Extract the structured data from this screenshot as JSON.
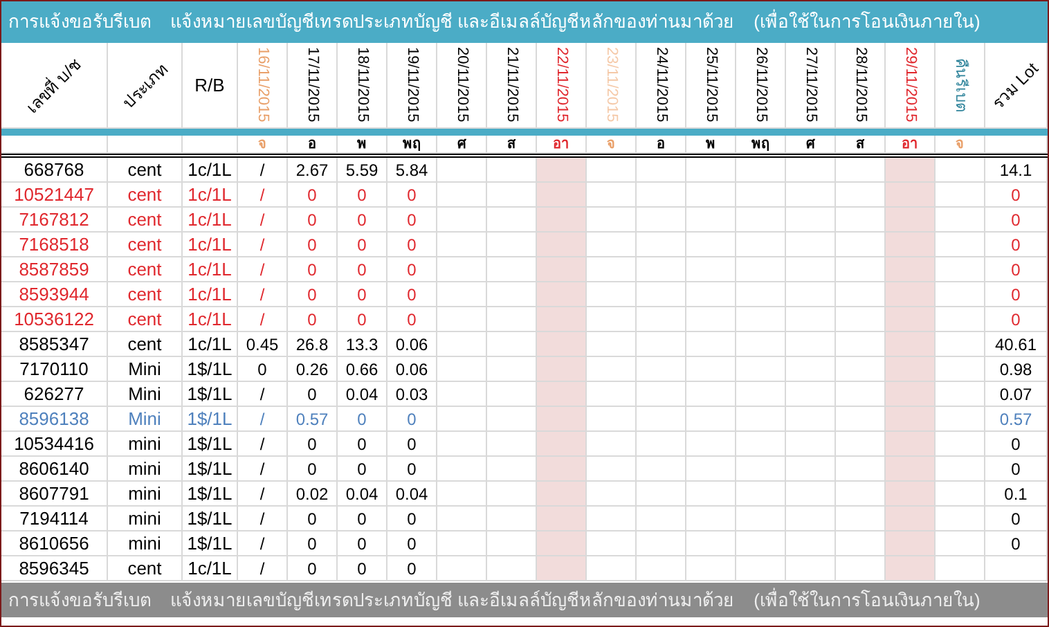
{
  "title": [
    "การแจ้งขอรับรีเบต",
    "แจ้งหมายเลขบัญชีเทรดประเภทบัญชี และอีเมลล์บัญชีหลักของท่านมาด้วย",
    "(เพื่อใช้ในการโอนเงินภายใน)"
  ],
  "columns": {
    "account": "เลขที่ บ/ช",
    "type": "ประเภท",
    "rb": "R/B",
    "rebate": "คืนรีเบต",
    "total": "รวม Lot"
  },
  "dates": [
    {
      "label": "16/11/2015",
      "color": "#e9a06a",
      "shaded": false,
      "weekday": {
        "label": "จ",
        "color": "#e9a06a"
      }
    },
    {
      "label": "17/11/2015",
      "color": "#000000",
      "shaded": false,
      "weekday": {
        "label": "อ",
        "color": "#000000"
      }
    },
    {
      "label": "18/11/2015",
      "color": "#000000",
      "shaded": false,
      "weekday": {
        "label": "พ",
        "color": "#000000"
      }
    },
    {
      "label": "19/11/2015",
      "color": "#000000",
      "shaded": false,
      "weekday": {
        "label": "พฤ",
        "color": "#000000"
      }
    },
    {
      "label": "20/11/2015",
      "color": "#000000",
      "shaded": false,
      "weekday": {
        "label": "ศ",
        "color": "#000000"
      }
    },
    {
      "label": "21/11/2015",
      "color": "#000000",
      "shaded": false,
      "weekday": {
        "label": "ส",
        "color": "#000000"
      }
    },
    {
      "label": "22/11/2015",
      "color": "#e0282e",
      "shaded": true,
      "weekday": {
        "label": "อา",
        "color": "#e0282e"
      }
    },
    {
      "label": "23/11/2015",
      "color": "#f5c9a8",
      "shaded": false,
      "weekday": {
        "label": "จ",
        "color": "#e9a06a"
      }
    },
    {
      "label": "24/11/2015",
      "color": "#000000",
      "shaded": false,
      "weekday": {
        "label": "อ",
        "color": "#000000"
      }
    },
    {
      "label": "25/11/2015",
      "color": "#000000",
      "shaded": false,
      "weekday": {
        "label": "พ",
        "color": "#000000"
      }
    },
    {
      "label": "26/11/2015",
      "color": "#000000",
      "shaded": false,
      "weekday": {
        "label": "พฤ",
        "color": "#000000"
      }
    },
    {
      "label": "27/11/2015",
      "color": "#000000",
      "shaded": false,
      "weekday": {
        "label": "ศ",
        "color": "#000000"
      }
    },
    {
      "label": "28/11/2015",
      "color": "#000000",
      "shaded": false,
      "weekday": {
        "label": "ส",
        "color": "#000000"
      }
    },
    {
      "label": "29/11/2015",
      "color": "#e0282e",
      "shaded": true,
      "weekday": {
        "label": "อา",
        "color": "#e0282e"
      }
    }
  ],
  "rebate_day": {
    "label": "จ",
    "color": "#e9a06a"
  },
  "rows": [
    {
      "account": "668768",
      "type": "cent",
      "rb": "1c/1L",
      "values": [
        "/",
        "2.67",
        "5.59",
        "5.84"
      ],
      "total": "14.1",
      "color": "#000000"
    },
    {
      "account": "10521447",
      "type": "cent",
      "rb": "1c/1L",
      "values": [
        "/",
        "0",
        "0",
        "0"
      ],
      "total": "0",
      "color": "#e0282e"
    },
    {
      "account": "7167812",
      "type": "cent",
      "rb": "1c/1L",
      "values": [
        "/",
        "0",
        "0",
        "0"
      ],
      "total": "0",
      "color": "#e0282e"
    },
    {
      "account": "7168518",
      "type": "cent",
      "rb": "1c/1L",
      "values": [
        "/",
        "0",
        "0",
        "0"
      ],
      "total": "0",
      "color": "#e0282e"
    },
    {
      "account": "8587859",
      "type": "cent",
      "rb": "1c/1L",
      "values": [
        "/",
        "0",
        "0",
        "0"
      ],
      "total": "0",
      "color": "#e0282e"
    },
    {
      "account": "8593944",
      "type": "cent",
      "rb": "1c/1L",
      "values": [
        "/",
        "0",
        "0",
        "0"
      ],
      "total": "0",
      "color": "#e0282e"
    },
    {
      "account": "10536122",
      "type": "cent",
      "rb": "1c/1L",
      "values": [
        "/",
        "0",
        "0",
        "0"
      ],
      "total": "0",
      "color": "#e0282e"
    },
    {
      "account": "8585347",
      "type": "cent",
      "rb": "1c/1L",
      "values": [
        "0.45",
        "26.8",
        "13.3",
        "0.06"
      ],
      "total": "40.61",
      "color": "#000000"
    },
    {
      "account": "7170110",
      "type": "Mini",
      "rb": "1$/1L",
      "values": [
        "0",
        "0.26",
        "0.66",
        "0.06"
      ],
      "total": "0.98",
      "color": "#000000"
    },
    {
      "account": "626277",
      "type": "Mini",
      "rb": "1$/1L",
      "values": [
        "/",
        "0",
        "0.04",
        "0.03"
      ],
      "total": "0.07",
      "color": "#000000"
    },
    {
      "account": "8596138",
      "type": "Mini",
      "rb": "1$/1L",
      "values": [
        "/",
        "0.57",
        "0",
        "0"
      ],
      "total": "0.57",
      "color": "#4f81bd"
    },
    {
      "account": "10534416",
      "type": "mini",
      "rb": "1$/1L",
      "values": [
        "/",
        "0",
        "0",
        "0"
      ],
      "total": "0",
      "color": "#000000"
    },
    {
      "account": "8606140",
      "type": "mini",
      "rb": "1$/1L",
      "values": [
        "/",
        "0",
        "0",
        "0"
      ],
      "total": "0",
      "color": "#000000"
    },
    {
      "account": "8607791",
      "type": "mini",
      "rb": "1$/1L",
      "values": [
        "/",
        "0.02",
        "0.04",
        "0.04"
      ],
      "total": "0.1",
      "color": "#000000"
    },
    {
      "account": "7194114",
      "type": "mini",
      "rb": "1$/1L",
      "values": [
        "/",
        "0",
        "0",
        "0"
      ],
      "total": "0",
      "color": "#000000"
    },
    {
      "account": "8610656",
      "type": "mini",
      "rb": "1$/1L",
      "values": [
        "/",
        "0",
        "0",
        "0"
      ],
      "total": "0",
      "color": "#000000"
    },
    {
      "account": "8596345",
      "type": "cent",
      "rb": "1c/1L",
      "values": [
        "/",
        "0",
        "0",
        "0"
      ],
      "color": "#000000"
    }
  ],
  "footer": [
    "การแจ้งขอรับรีเบต",
    "แจ้งหมายเลขบัญชีเทรดประเภทบัญชี และอีเมลล์บัญชีหลักของท่านมาด้วย",
    "(เพื่อใช้ในการโอนเงินภายใน)"
  ]
}
